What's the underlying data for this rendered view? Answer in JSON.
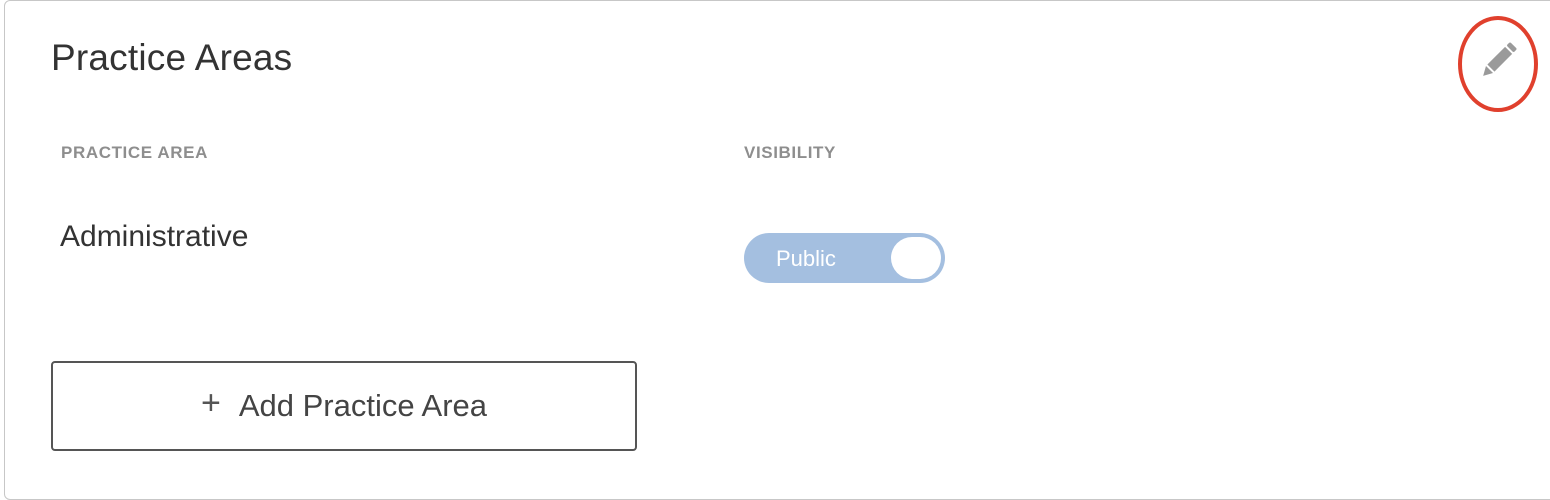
{
  "section": {
    "title": "Practice Areas",
    "edit_icon": "pencil-icon",
    "highlight_color": "#e0402d"
  },
  "table": {
    "headers": [
      "PRACTICE AREA",
      "VISIBILITY"
    ],
    "rows": [
      {
        "practice_area": "Administrative",
        "visibility": "Public",
        "visibility_toggle_on": true
      }
    ]
  },
  "add_button": {
    "icon": "plus-icon",
    "label": "Add Practice Area"
  },
  "colors": {
    "toggle_bg": "#a4bfe0",
    "header_text": "#8e8e8e",
    "body_text": "#333333"
  }
}
